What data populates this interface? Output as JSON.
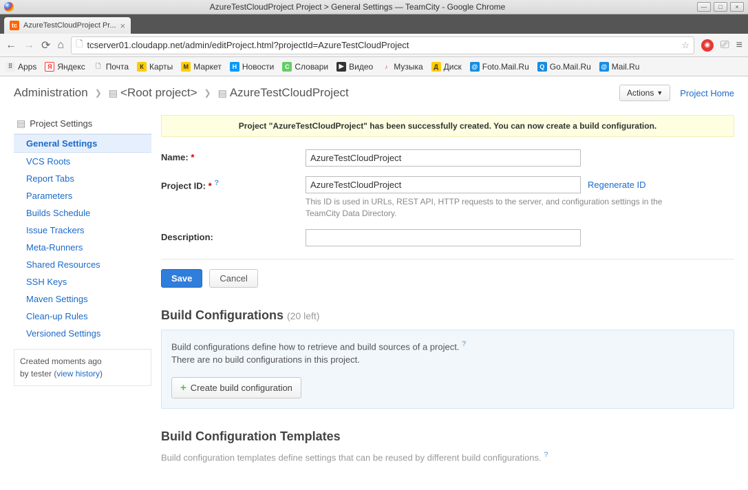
{
  "window": {
    "title": "AzureTestCloudProject Project > General Settings — TeamCity - Google Chrome"
  },
  "tab": {
    "title": "AzureTestCloudProject Pr..."
  },
  "address": {
    "url": "tcserver01.cloudapp.net/admin/editProject.html?projectId=AzureTestCloudProject"
  },
  "bookmarks": [
    {
      "label": "Apps"
    },
    {
      "label": "Яндекс"
    },
    {
      "label": "Почта"
    },
    {
      "label": "Карты"
    },
    {
      "label": "Маркет"
    },
    {
      "label": "Новости"
    },
    {
      "label": "Словари"
    },
    {
      "label": "Видео"
    },
    {
      "label": "Музыка"
    },
    {
      "label": "Диск"
    },
    {
      "label": "Foto.Mail.Ru"
    },
    {
      "label": "Go.Mail.Ru"
    },
    {
      "label": "Mail.Ru"
    }
  ],
  "breadcrumb": {
    "admin": "Administration",
    "root": "<Root project>",
    "current": "AzureTestCloudProject"
  },
  "topright": {
    "actions": "Actions",
    "project_home": "Project Home"
  },
  "sidebar": {
    "header": "Project Settings",
    "items": [
      {
        "label": "General Settings"
      },
      {
        "label": "VCS Roots"
      },
      {
        "label": "Report Tabs"
      },
      {
        "label": "Parameters"
      },
      {
        "label": "Builds Schedule"
      },
      {
        "label": "Issue Trackers"
      },
      {
        "label": "Meta-Runners"
      },
      {
        "label": "Shared Resources"
      },
      {
        "label": "SSH Keys"
      },
      {
        "label": "Maven Settings"
      },
      {
        "label": "Clean-up Rules"
      },
      {
        "label": "Versioned Settings"
      }
    ],
    "meta": {
      "line1": "Created moments ago",
      "line2_prefix": "by tester  (",
      "view_history": "view history",
      "line2_suffix": ")"
    }
  },
  "notice": "Project \"AzureTestCloudProject\" has been successfully created. You can now create a build configuration.",
  "form": {
    "name_label": "Name:",
    "name_value": "AzureTestCloudProject",
    "projectid_label": "Project ID:",
    "projectid_value": "AzureTestCloudProject",
    "regenerate": "Regenerate ID",
    "projectid_hint": "This ID is used in URLs, REST API, HTTP requests to the server, and configuration settings in the TeamCity Data Directory.",
    "description_label": "Description:",
    "description_value": "",
    "save": "Save",
    "cancel": "Cancel"
  },
  "buildconf": {
    "title": "Build Configurations",
    "count": "(20 left)",
    "desc1": "Build configurations define how to retrieve and build sources of a project.",
    "desc2": "There are no build configurations in this project.",
    "create": "Create build configuration"
  },
  "templates": {
    "title": "Build Configuration Templates",
    "desc": "Build configuration templates define settings that can be reused by different build configurations."
  }
}
